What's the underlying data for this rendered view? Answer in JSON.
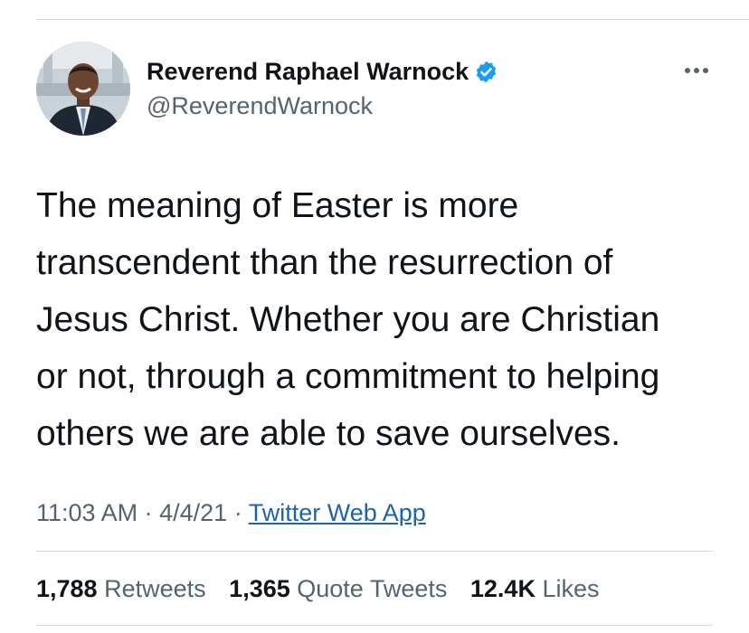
{
  "profile": {
    "display_name": "Reverend Raphael Warnock",
    "handle": "@ReverendWarnock",
    "verified": true,
    "verified_color": "#1d9bf0"
  },
  "tweet": {
    "lines": [
      "The meaning of Easter is more",
      "transcendent than the resurrection of",
      "Jesus Christ. Whether you are Christian",
      "or not, through a commitment to helping",
      "others we are able to save ourselves."
    ]
  },
  "meta": {
    "time": "11:03 AM",
    "separator": "·",
    "date": "4/4/21",
    "source": "Twitter Web App"
  },
  "stats": {
    "retweets_count": "1,788",
    "retweets_label": "Retweets",
    "quotes_count": "1,365",
    "quotes_label": "Quote Tweets",
    "likes_count": "12.4K",
    "likes_label": "Likes"
  },
  "colors": {
    "text": "#0f1419",
    "secondary": "#536471",
    "link": "#1d65a6",
    "divider": "#cfd9de"
  }
}
